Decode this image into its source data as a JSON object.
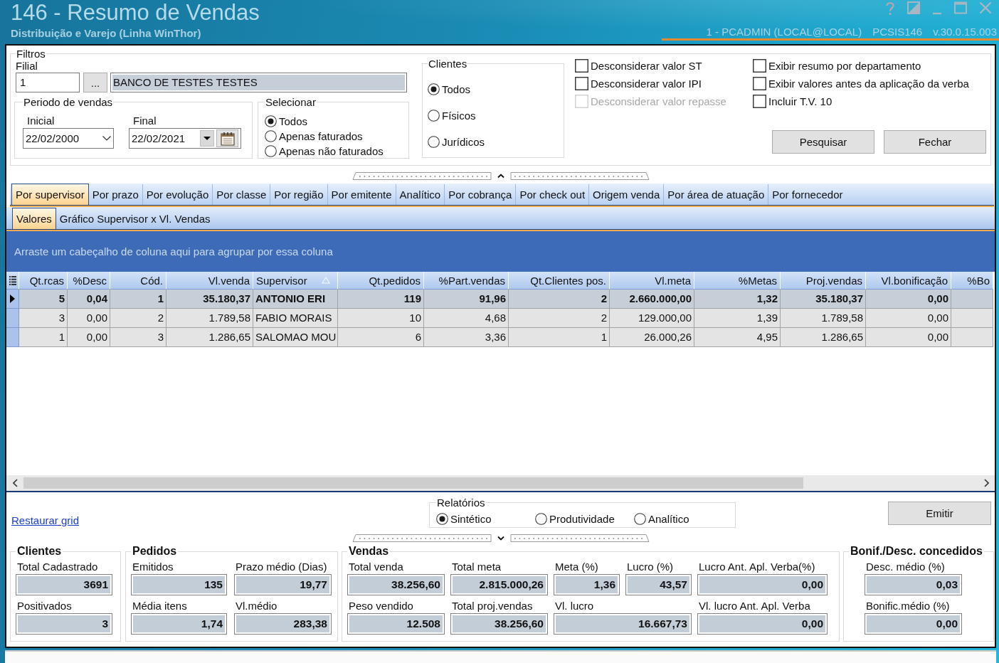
{
  "window": {
    "title": "146 - Resumo de Vendas",
    "subtitle": "Distribuição e Varejo (Linha WinThor)",
    "session": "1 - PCADMIN (LOCAL@LOCAL)",
    "program": "PCSIS146",
    "version": "v.30.0.15.003"
  },
  "filters": {
    "title": "Filtros",
    "filial": {
      "label": "Filial",
      "code": "1",
      "lookup_button": "...",
      "name": "BANCO DE TESTES TESTES"
    },
    "period": {
      "title": "Periodo de vendas",
      "start": {
        "label": "Inicial",
        "value": "22/02/2000"
      },
      "end": {
        "label": "Final",
        "value": "22/02/2021"
      }
    },
    "selecionar": {
      "title": "Selecionar",
      "options": [
        {
          "label": "Todos",
          "selected": true
        },
        {
          "label": "Apenas faturados",
          "selected": false
        },
        {
          "label": "Apenas não faturados",
          "selected": false
        }
      ]
    },
    "clientes": {
      "title": "Clientes",
      "options": [
        {
          "label": "Todos",
          "selected": true
        },
        {
          "label": "Físicos",
          "selected": false
        },
        {
          "label": "Jurídicos",
          "selected": false
        }
      ]
    },
    "checkboxes": [
      {
        "label": "Desconsiderar valor ST",
        "checked": false,
        "disabled": false
      },
      {
        "label": "Desconsiderar valor IPI",
        "checked": false,
        "disabled": false
      },
      {
        "label": "Desconsiderar valor repasse",
        "checked": false,
        "disabled": true
      },
      {
        "label": "Exibir resumo por departamento",
        "checked": false,
        "disabled": false
      },
      {
        "label": "Exibir valores antes da aplicação da verba",
        "checked": false,
        "disabled": false
      },
      {
        "label": "Incluir T.V. 10",
        "checked": false,
        "disabled": false
      }
    ],
    "buttons": [
      "Pesquisar",
      "Fechar"
    ]
  },
  "tabs": [
    {
      "label": "Por supervisor",
      "selected": true
    },
    {
      "label": "Por prazo",
      "selected": false
    },
    {
      "label": "Por evolução",
      "selected": false
    },
    {
      "label": "Por classe",
      "selected": false
    },
    {
      "label": "Por região",
      "selected": false
    },
    {
      "label": "Por emitente",
      "selected": false
    },
    {
      "label": "Analítico",
      "selected": false
    },
    {
      "label": "Por cobrança",
      "selected": false
    },
    {
      "label": "Por check out",
      "selected": false
    },
    {
      "label": "Origem venda",
      "selected": false
    },
    {
      "label": "Por área de atuação",
      "selected": false
    },
    {
      "label": "Por fornecedor",
      "selected": false
    }
  ],
  "subtabs": [
    {
      "label": "Valores",
      "selected": true
    },
    {
      "label": "Gráfico Supervisor x Vl. Vendas",
      "selected": false
    }
  ],
  "grid": {
    "group_hint": "Arraste um cabeçalho de coluna aqui para agrupar por essa coluna",
    "columns": [
      {
        "label": "Qt.rcas",
        "kind": "number",
        "sorted": false
      },
      {
        "label": "%Desc",
        "kind": "number",
        "sorted": false
      },
      {
        "label": "Cód.",
        "kind": "number",
        "sorted": false
      },
      {
        "label": "Vl.venda",
        "kind": "number",
        "sorted": false
      },
      {
        "label": "Supervisor",
        "kind": "text",
        "sorted": true
      },
      {
        "label": "Qt.pedidos",
        "kind": "number",
        "sorted": false
      },
      {
        "label": "%Part.vendas",
        "kind": "number",
        "sorted": false
      },
      {
        "label": "Qt.Clientes pos.",
        "kind": "number",
        "sorted": false
      },
      {
        "label": "Vl.meta",
        "kind": "number",
        "sorted": false
      },
      {
        "label": "%Metas",
        "kind": "number",
        "sorted": false
      },
      {
        "label": "Proj.vendas",
        "kind": "number",
        "sorted": false
      },
      {
        "label": "Vl.bonificação",
        "kind": "number",
        "sorted": false
      },
      {
        "label": "%Bo",
        "kind": "number",
        "sorted": false
      }
    ],
    "rows": [
      {
        "selected": true,
        "cells": [
          "5",
          "0,04",
          "1",
          "35.180,37",
          "ANTONIO ERI",
          "119",
          "91,96",
          "2",
          "2.660.000,00",
          "1,32",
          "35.180,37",
          "0,00"
        ]
      },
      {
        "selected": false,
        "cells": [
          "3",
          "0,00",
          "2",
          "1.789,58",
          "FABIO MORAIS",
          "10",
          "4,68",
          "2",
          "129.000,00",
          "1,39",
          "1.789,58",
          "0,00"
        ]
      },
      {
        "selected": false,
        "cells": [
          "1",
          "0,00",
          "3",
          "1.286,65",
          "SALOMAO MOU",
          "6",
          "3,36",
          "1",
          "26.000,26",
          "4,95",
          "1.286,65",
          "0,00"
        ]
      }
    ]
  },
  "restore_link": "Restaurar grid",
  "reports": {
    "title": "Relatórios",
    "options": [
      {
        "label": "Sintético",
        "selected": true
      },
      {
        "label": "Produtividade",
        "selected": false
      },
      {
        "label": "Analítico",
        "selected": false
      }
    ]
  },
  "emit_button": "Emitir",
  "summary": [
    {
      "title": "Clientes",
      "fields": [
        {
          "label": "Total Cadastrado",
          "value": "3691"
        },
        {
          "label": "Positivados",
          "value": "3"
        }
      ]
    },
    {
      "title": "Pedidos",
      "fields": [
        {
          "label": "Emitidos",
          "value": "135"
        },
        {
          "label": "Prazo médio (Dias)",
          "value": "19,77"
        },
        {
          "label": "Média itens",
          "value": "1,74"
        },
        {
          "label": "Vl.médio",
          "value": "283,38"
        }
      ]
    },
    {
      "title": "Vendas",
      "fields": [
        {
          "label": "Total venda",
          "value": "38.256,60"
        },
        {
          "label": "Total meta",
          "value": "2.815.000,26"
        },
        {
          "label": "Meta (%)",
          "value": "1,36"
        },
        {
          "label": "Lucro (%)",
          "value": "43,57"
        },
        {
          "label": "Lucro Ant. Apl. Verba(%)",
          "value": "0,00"
        },
        {
          "label": "Peso vendido",
          "value": "12.508"
        },
        {
          "label": "Total proj.vendas",
          "value": "38.256,60"
        },
        {
          "label": "Vl. lucro",
          "value": "16.667,73"
        },
        {
          "label": "Vl. lucro Ant. Apl. Verba",
          "value": "0,00"
        }
      ]
    },
    {
      "title": "Bonif./Desc. concedidos",
      "fields": [
        {
          "label": "Desc. médio (%)",
          "value": "0,03"
        },
        {
          "label": "Bonific.médio (%)",
          "value": "0,00"
        }
      ]
    }
  ]
}
